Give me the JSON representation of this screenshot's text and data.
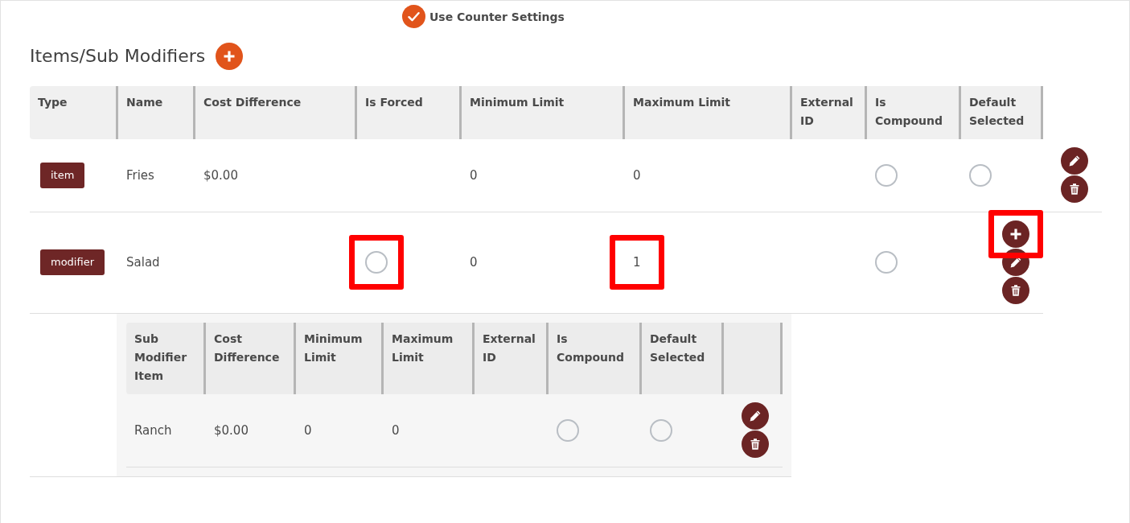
{
  "use_counter_settings": {
    "label": "Use Counter Settings",
    "checked": true
  },
  "section": {
    "title": "Items/Sub Modifiers"
  },
  "table": {
    "columns": [
      "Type",
      "Name",
      "Cost Difference",
      "Is Forced",
      "Minimum Limit",
      "Maximum Limit",
      "External ID",
      "Is Compound",
      "Default Selected"
    ],
    "rows": [
      {
        "cells": [
          {
            "kind": "badge",
            "text": "item",
            "highlighted": false
          },
          {
            "kind": "text",
            "text": "Fries",
            "highlighted": false
          },
          {
            "kind": "text",
            "text": "$0.00",
            "highlighted": false
          },
          {
            "kind": "empty",
            "highlighted": false
          },
          {
            "kind": "text",
            "text": "0",
            "highlighted": false
          },
          {
            "kind": "text",
            "text": "0",
            "highlighted": false
          },
          {
            "kind": "empty",
            "highlighted": false
          },
          {
            "kind": "radio",
            "checked": false,
            "highlighted": false
          },
          {
            "kind": "radio",
            "checked": false,
            "highlighted": false
          },
          {
            "kind": "actions",
            "highlighted": false,
            "buttons": [
              {
                "kind": "edit",
                "highlighted": false
              },
              {
                "kind": "delete",
                "highlighted": false
              }
            ]
          }
        ]
      },
      {
        "cells": [
          {
            "kind": "badge",
            "text": "modifier",
            "highlighted": false
          },
          {
            "kind": "text",
            "text": "Salad",
            "highlighted": false
          },
          {
            "kind": "empty",
            "highlighted": false
          },
          {
            "kind": "radio",
            "checked": false,
            "highlighted": true
          },
          {
            "kind": "text",
            "text": "0",
            "highlighted": false
          },
          {
            "kind": "text",
            "text": "1",
            "highlighted": true
          },
          {
            "kind": "empty",
            "highlighted": false
          },
          {
            "kind": "radio",
            "checked": false,
            "highlighted": false
          },
          {
            "kind": "actions",
            "highlighted": false,
            "buttons": [
              {
                "kind": "add",
                "highlighted": true
              },
              {
                "kind": "edit",
                "highlighted": false
              },
              {
                "kind": "delete",
                "highlighted": false
              }
            ]
          }
        ],
        "sub_table": {
          "columns": [
            "Sub Modifier Item",
            "Cost Difference",
            "Minimum Limit",
            "Maximum Limit",
            "External ID",
            "Is Compound",
            "Default Selected"
          ],
          "rows": [
            {
              "cells": [
                {
                  "kind": "text",
                  "text": "Ranch"
                },
                {
                  "kind": "text",
                  "text": "$0.00"
                },
                {
                  "kind": "text",
                  "text": "0"
                },
                {
                  "kind": "text",
                  "text": "0"
                },
                {
                  "kind": "empty"
                },
                {
                  "kind": "radio",
                  "checked": false
                },
                {
                  "kind": "radio",
                  "checked": false
                },
                {
                  "kind": "actions",
                  "buttons": [
                    {
                      "kind": "edit",
                      "highlighted": false
                    },
                    {
                      "kind": "delete",
                      "highlighted": false
                    }
                  ]
                }
              ]
            }
          ]
        }
      }
    ]
  }
}
